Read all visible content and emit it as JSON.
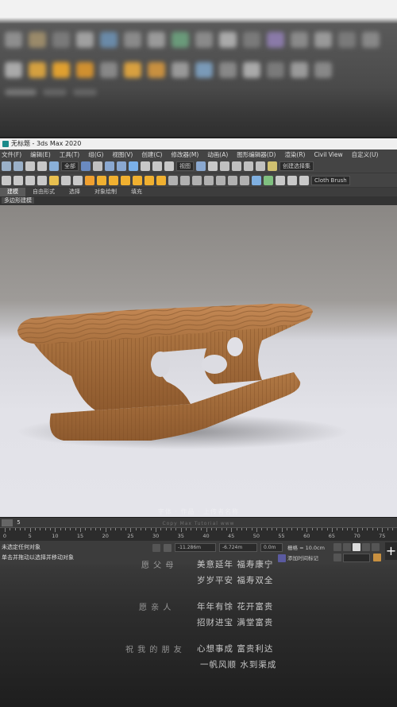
{
  "window": {
    "title": "无标题 - 3ds Max 2020"
  },
  "menu": [
    "文件(F)",
    "编辑(E)",
    "工具(T)",
    "组(G)",
    "视图(V)",
    "创建(C)",
    "修改器(M)",
    "动画(A)",
    "图形编辑器(D)",
    "渲染(R)",
    "Civil View",
    "自定义(U)"
  ],
  "toolbar": {
    "filter_select": "全部",
    "view_select": "视图",
    "selection_set": "创建选择集",
    "brush_label": "Cloth Brush"
  },
  "ribbon": {
    "tabs": [
      "建模",
      "自由形式",
      "选择",
      "对象绘制",
      "填充"
    ],
    "active_tab": "建模",
    "subpanel": "多边形建模"
  },
  "timeline": {
    "frame_display": "5",
    "ticks": [
      "0",
      "5",
      "10",
      "15",
      "20",
      "25",
      "30",
      "35",
      "40",
      "45",
      "50",
      "55",
      "60",
      "65",
      "70",
      "75"
    ]
  },
  "status": {
    "line1": "未选定任何对象",
    "line2": "单击并拖动以选择并移动对象",
    "x_value": "-11.286m",
    "y_value": "-6.724m",
    "z_value": "0.0m",
    "grid": "栅格 = 10.0cm",
    "add_time_tag": "添加时间标记"
  },
  "overlay": {
    "watermark_line1": "字体 · 作品 · 上传者名称",
    "watermark_line2": "Copy Max Tutorial www",
    "poem": [
      {
        "who": "愿 父 母",
        "line": "美意延年  福寿康宁"
      },
      {
        "who": "",
        "line": "岁岁平安  福寿双全"
      },
      {
        "who": "愿 亲 人",
        "line": "年年有馀  花开富贵"
      },
      {
        "who": "",
        "line": "招财进宝  满堂富贵"
      },
      {
        "who": "祝 我 的 朋 友",
        "line": "心想事成  富贵利达"
      },
      {
        "who": "",
        "line": "一帆风顺  水到渠成"
      }
    ]
  },
  "colors": {
    "ui_dark": "#444444",
    "viewport_bg": "#e2e2e8",
    "wood": "#b87c4c"
  }
}
